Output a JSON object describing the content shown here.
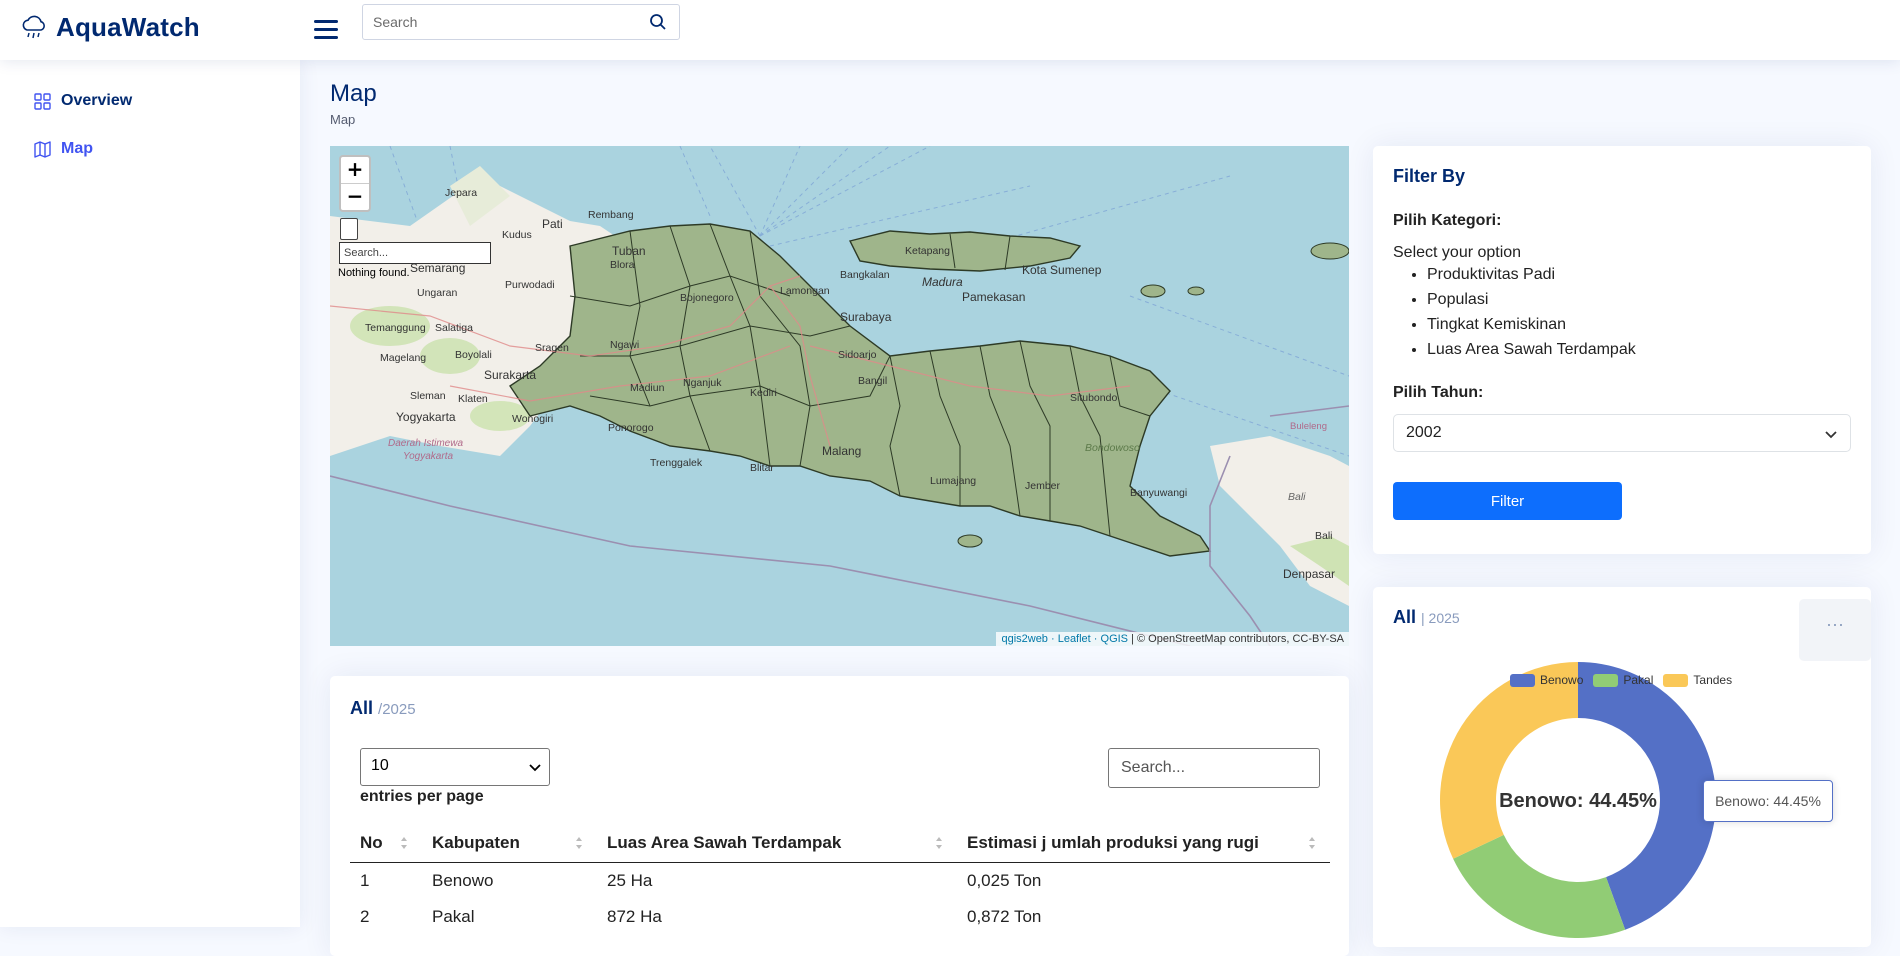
{
  "header": {
    "brand": "AquaWatch",
    "search_placeholder": "Search"
  },
  "sidebar": {
    "items": [
      {
        "label": "Overview",
        "icon": "grid-icon",
        "active": false
      },
      {
        "label": "Map",
        "icon": "map-icon",
        "active": true
      }
    ]
  },
  "page": {
    "title": "Map",
    "breadcrumb": "Map"
  },
  "map": {
    "zoom_in": "+",
    "zoom_out": "−",
    "search_placeholder": "Search...",
    "search_status": "Nothing found.",
    "attribution_links": "qgis2web · Leaflet · QGIS",
    "attribution_text": "| © OpenStreetMap contributors, CC-BY-SA",
    "place_labels": [
      "Jepara",
      "Pati",
      "Rembang",
      "Kudus",
      "Tuban",
      "Blora",
      "Semarang",
      "Ungaran",
      "Purwodadi",
      "Bojonegoro",
      "Lamongan",
      "Bangkalan",
      "Madura",
      "Pamekasan",
      "Kota Sumenep",
      "Ketapang",
      "Surabaya",
      "Temanggung",
      "Salatiga",
      "Sragen",
      "Ngawi",
      "Sidoarjo",
      "Magelang",
      "Boyolali",
      "Surakarta",
      "Nganjuk",
      "Kediri",
      "Bangil",
      "Sleman",
      "Klaten",
      "Yogyakarta",
      "Wonogiri",
      "Madiun",
      "Ponorogo",
      "Blitar",
      "Malang",
      "Lumajang",
      "Jember",
      "Situbondo",
      "Bondowoso",
      "Banyuwangi",
      "Trenggalek",
      "Buleleng",
      "Bali",
      "Denpasar",
      "Daerah Istimewa Yogyakarta"
    ]
  },
  "filter": {
    "title": "Filter By",
    "category_label": "Pilih Kategori:",
    "option_header": "Select your option",
    "options": [
      "Produktivitas Padi",
      "Populasi",
      "Tingkat Kemiskinan",
      "Luas Area Sawah Terdampak"
    ],
    "year_label": "Pilih Tahun:",
    "year_value": "2002",
    "button": "Filter"
  },
  "chart_card": {
    "title": "All",
    "subtitle": "| 2025",
    "more": "···",
    "tooltip": "Benowo: 44.45%",
    "center_label": "Benowo: 44.45%"
  },
  "chart_data": {
    "type": "pie",
    "categories": [
      "Benowo",
      "Pakal",
      "Tandes"
    ],
    "values": [
      44.45,
      23.55,
      32.0
    ],
    "colors": [
      "#5470c6",
      "#91cc75",
      "#fac858"
    ],
    "legend": "top"
  },
  "table": {
    "title": "All",
    "subtitle": "/2025",
    "entries_value": "10",
    "entries_label": "entries per page",
    "search_placeholder": "Search...",
    "columns": [
      "No",
      "Kabupaten",
      "Luas Area Sawah Terdampak",
      "Estimasi j umlah produksi yang rugi"
    ],
    "rows": [
      [
        "1",
        "Benowo",
        "25 Ha",
        "0,025 Ton"
      ],
      [
        "2",
        "Pakal",
        "872 Ha",
        "0,872 Ton"
      ]
    ]
  }
}
